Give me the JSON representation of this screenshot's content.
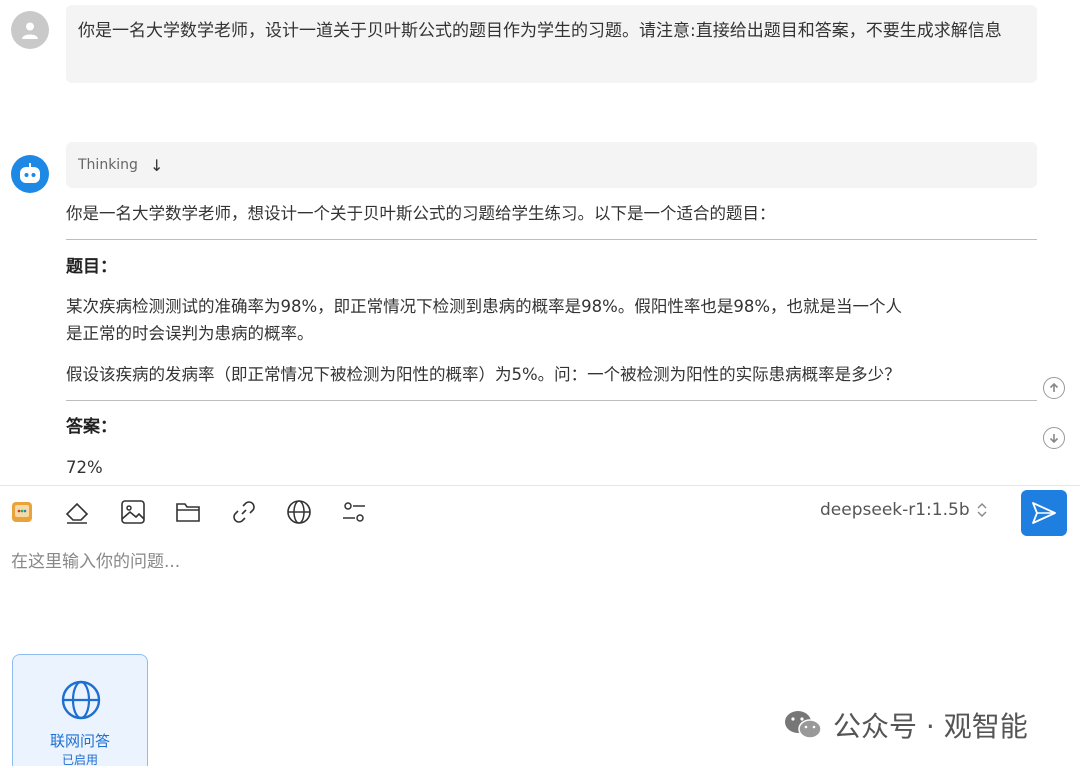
{
  "conversation": {
    "user_message": "你是一名大学数学老师，设计一道关于贝叶斯公式的题目作为学生的习题。请注意:直接给出题目和答案，不要生成求解信息",
    "thinking_label": "Thinking",
    "thinking_arrow": "↓",
    "intro": "你是一名大学数学老师，想设计一个关于贝叶斯公式的习题给学生练习。以下是一个适合的题目：",
    "question_heading": "题目：",
    "question_p1_line1": "某次疾病检测测试的准确率为98%，即正常情况下检测到患病的概率是98%。假阳性率也是98%，也就是当一个人",
    "question_p1_line2": "是正常的时会误判为患病的概率。",
    "question_p2": "假设该疾病的发病率（即正常情况下被检测为阳性的概率）为5%。问：一个被检测为阳性的实际患病概率是多少？",
    "answer_heading": "答案：",
    "answer_value": "72%"
  },
  "toolbar": {
    "icons": [
      "app-icon",
      "eraser-icon",
      "image-icon",
      "folder-icon",
      "link-icon",
      "globe-icon",
      "settings-sliders-icon"
    ],
    "model_name": "deepseek-r1:1.5b",
    "model_chevron": "⌃⌄"
  },
  "input": {
    "placeholder": "在这里输入你的问题..."
  },
  "web_qa": {
    "label": "联网问答",
    "status": "已启用"
  },
  "watermark": {
    "text": "公众号 · 观智能"
  },
  "colors": {
    "accent": "#1e7fe0",
    "bubble_bg": "#f4f4f4",
    "user_avatar": "#c9c9c9"
  }
}
